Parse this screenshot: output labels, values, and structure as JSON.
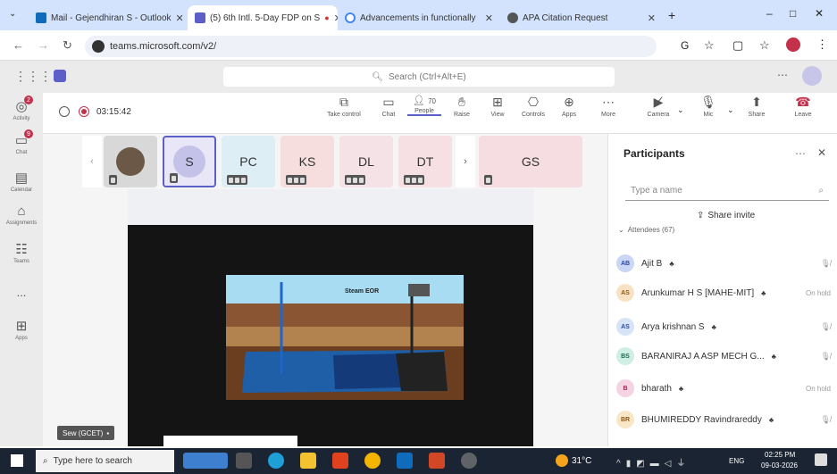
{
  "browser": {
    "tabs": [
      {
        "label": "Mail - Gejendhiran S - Outlook",
        "favicon": "outlook-icon",
        "color": "#0f6cbd"
      },
      {
        "label": "(5) 6th Intl. 5-Day FDP on S",
        "favicon": "teams-icon",
        "color": "#5b5fc7"
      },
      {
        "label": "Advancements in functionally",
        "favicon": "google-icon",
        "color": "#4285f4"
      },
      {
        "label": "APA Citation Request",
        "favicon": "chatgpt-icon",
        "color": "#555555"
      }
    ],
    "url": "teams.microsoft.com/v2/"
  },
  "teams": {
    "search_placeholder": "Search (Ctrl+Alt+E)",
    "rail": [
      {
        "label": "Activity",
        "icon": "bell-icon",
        "badge": "2"
      },
      {
        "label": "Chat",
        "icon": "chat-icon",
        "badge": "9"
      },
      {
        "label": "Calendar",
        "icon": "calendar-icon",
        "badge": ""
      },
      {
        "label": "Assignments",
        "icon": "assignments-icon",
        "badge": ""
      },
      {
        "label": "Teams",
        "icon": "teams-icon",
        "badge": ""
      },
      {
        "label": "...",
        "icon": "more-icon",
        "badge": ""
      },
      {
        "label": "Apps",
        "icon": "apps-icon",
        "badge": ""
      }
    ],
    "meeting_timer": "03:15:42",
    "toolbar": [
      {
        "label": "Take control",
        "icon": "take-control-icon"
      },
      {
        "label": "Chat",
        "icon": "chat-icon"
      },
      {
        "label": "People",
        "icon": "people-icon",
        "count": "70"
      },
      {
        "label": "Raise",
        "icon": "raise-hand-icon"
      },
      {
        "label": "View",
        "icon": "view-icon"
      },
      {
        "label": "Controls",
        "icon": "controls-icon"
      },
      {
        "label": "Apps",
        "icon": "apps-icon"
      },
      {
        "label": "More",
        "icon": "more-icon"
      },
      {
        "label": "Camera",
        "icon": "camera-off-icon"
      },
      {
        "label": "Mic",
        "icon": "mic-off-icon"
      },
      {
        "label": "Share",
        "icon": "share-icon"
      },
      {
        "label": "Leave",
        "icon": "leave-icon"
      }
    ],
    "tiles": [
      {
        "initials": "",
        "bg": "#d8d8d8"
      },
      {
        "initials": "S",
        "bg": "#e8e6f7"
      },
      {
        "initials": "PC",
        "bg": "#ddeef5"
      },
      {
        "initials": "KS",
        "bg": "#f6dede"
      },
      {
        "initials": "DL",
        "bg": "#f5e2e6"
      },
      {
        "initials": "DT",
        "bg": "#f7e0e4"
      },
      {
        "initials": "GS",
        "bg": "#f5dde2"
      }
    ],
    "screen_share": {
      "slide_title": "Steam EOR",
      "presenter_label": "Sew (GCET)"
    }
  },
  "participants": {
    "title": "Participants",
    "search_placeholder": "Type a name",
    "share_invite": "Share invite",
    "section": "Attendees (67)",
    "list": [
      {
        "initials": "AB",
        "name": "Ajit B",
        "status": "",
        "color": "#c9d6f5"
      },
      {
        "initials": "AS",
        "name": "Arunkumar H S [MAHE-MIT]",
        "status": "On hold",
        "color": "#f9e2c4"
      },
      {
        "initials": "AS",
        "name": "Arya krishnan S",
        "status": "",
        "color": "#d6e4f7"
      },
      {
        "initials": "BS",
        "name": "BARANIRAJ A ASP MECH G...",
        "status": "",
        "color": "#cfeee4"
      },
      {
        "initials": "B",
        "name": "bharath",
        "status": "On hold",
        "color": "#f4d3e2"
      },
      {
        "initials": "BR",
        "name": "BHUMIREDDY Ravindrareddy",
        "status": "",
        "color": "#f9e6c6"
      }
    ]
  },
  "taskbar": {
    "search_placeholder": "Type here to search",
    "weather": "31°C",
    "lang": "ENG",
    "time": "02:25 PM",
    "date": "09-03-2026"
  }
}
